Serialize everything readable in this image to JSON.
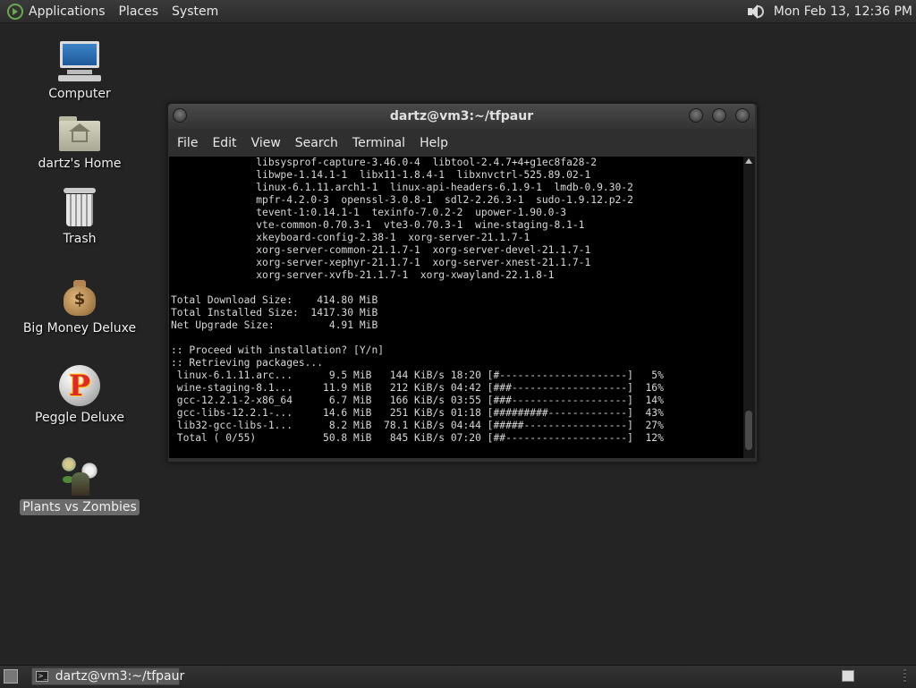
{
  "top_panel": {
    "menus": [
      "Applications",
      "Places",
      "System"
    ],
    "clock": "Mon Feb 13, 12:36 PM"
  },
  "desktop_icons": {
    "computer": "Computer",
    "home": "dartz's Home",
    "trash": "Trash",
    "big_money": "Big Money Deluxe",
    "peggle": "Peggle Deluxe",
    "plants": "Plants vs Zombies"
  },
  "terminal": {
    "title": "dartz@vm3:~/tfpaur",
    "menu": [
      "File",
      "Edit",
      "View",
      "Search",
      "Terminal",
      "Help"
    ],
    "lines": [
      "              libsysprof-capture-3.46.0-4  libtool-2.4.7+4+g1ec8fa28-2",
      "              libwpe-1.14.1-1  libx11-1.8.4-1  libxnvctrl-525.89.02-1",
      "              linux-6.1.11.arch1-1  linux-api-headers-6.1.9-1  lmdb-0.9.30-2",
      "              mpfr-4.2.0-3  openssl-3.0.8-1  sdl2-2.26.3-1  sudo-1.9.12.p2-2",
      "              tevent-1:0.14.1-1  texinfo-7.0.2-2  upower-1.90.0-3",
      "              vte-common-0.70.3-1  vte3-0.70.3-1  wine-staging-8.1-1",
      "              xkeyboard-config-2.38-1  xorg-server-21.1.7-1",
      "              xorg-server-common-21.1.7-1  xorg-server-devel-21.1.7-1",
      "              xorg-server-xephyr-21.1.7-1  xorg-server-xnest-21.1.7-1",
      "              xorg-server-xvfb-21.1.7-1  xorg-xwayland-22.1.8-1",
      "",
      "Total Download Size:    414.80 MiB",
      "Total Installed Size:  1417.30 MiB",
      "Net Upgrade Size:         4.91 MiB",
      "",
      ":: Proceed with installation? [Y/n]",
      ":: Retrieving packages...",
      " linux-6.1.11.arc...      9.5 MiB   144 KiB/s 18:20 [#---------------------]   5%",
      " wine-staging-8.1...     11.9 MiB   212 KiB/s 04:42 [###-------------------]  16%",
      " gcc-12.2.1-2-x86_64      6.7 MiB   166 KiB/s 03:55 [###-------------------]  14%",
      " gcc-libs-12.2.1-...     14.6 MiB   251 KiB/s 01:18 [#########-------------]  43%",
      " lib32-gcc-libs-1...      8.2 MiB  78.1 KiB/s 04:44 [#####-----------------]  27%",
      " Total ( 0/55)           50.8 MiB   845 KiB/s 07:20 [##--------------------]  12%"
    ]
  },
  "taskbar": {
    "window_button": "dartz@vm3:~/tfpaur"
  }
}
